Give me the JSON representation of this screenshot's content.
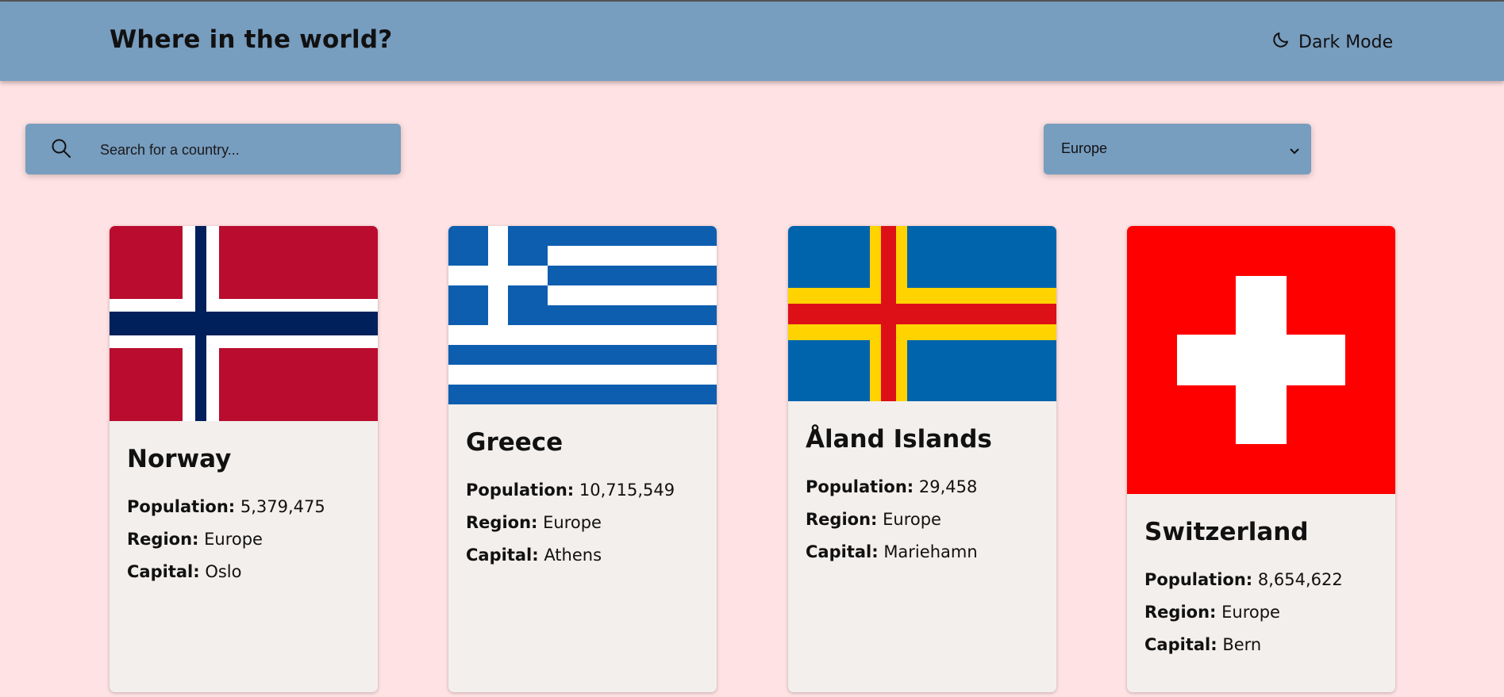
{
  "header": {
    "title": "Where in the world?",
    "dark_mode_label": "Dark Mode",
    "dark_mode_icon": "moon-icon"
  },
  "search": {
    "placeholder": "Search for a country...",
    "value": "",
    "icon": "search-icon"
  },
  "region_filter": {
    "selected": "Europe"
  },
  "labels": {
    "population": "Population:",
    "region": "Region:",
    "capital": "Capital:"
  },
  "countries": [
    {
      "name": "Norway",
      "population": "5,379,475",
      "region": "Europe",
      "capital": "Oslo"
    },
    {
      "name": "Greece",
      "population": "10,715,549",
      "region": "Europe",
      "capital": "Athens"
    },
    {
      "name": "Åland Islands",
      "population": "29,458",
      "region": "Europe",
      "capital": "Mariehamn"
    },
    {
      "name": "Switzerland",
      "population": "8,654,622",
      "region": "Europe",
      "capital": "Bern"
    }
  ],
  "colors": {
    "background": "#ffe2e3",
    "header": "#779dbf",
    "card": "#f3efec"
  }
}
